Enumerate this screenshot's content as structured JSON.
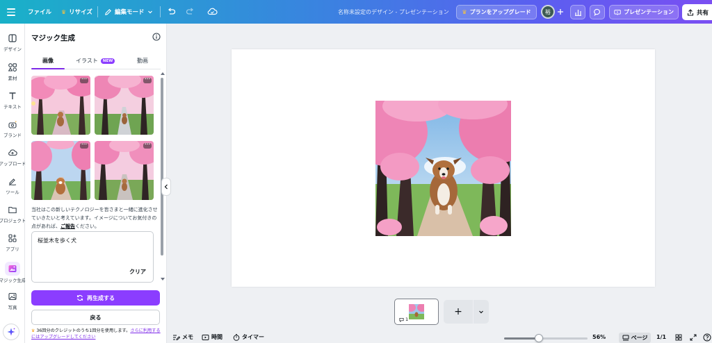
{
  "topbar": {
    "file_label": "ファイル",
    "resize_label": "リサイズ",
    "edit_mode_label": "編集モード",
    "doc_title": "名称未設定のデザイン - プレゼンテーション",
    "upgrade_label": "プランをアップグレード",
    "avatar_initial": "裕",
    "present_label": "プレゼンテーション",
    "share_label": "共有"
  },
  "rail": {
    "items": [
      {
        "label": "デザイン",
        "icon": "layout-icon"
      },
      {
        "label": "素材",
        "icon": "elements-icon"
      },
      {
        "label": "テキスト",
        "icon": "text-icon"
      },
      {
        "label": "ブランド",
        "icon": "brand-icon"
      },
      {
        "label": "アップロード",
        "icon": "upload-icon"
      },
      {
        "label": "ツール",
        "icon": "draw-icon"
      },
      {
        "label": "プロジェクト",
        "icon": "folder-icon"
      },
      {
        "label": "アプリ",
        "icon": "apps-icon"
      },
      {
        "label": "マジック生成",
        "icon": "magic-media-icon"
      },
      {
        "label": "写真",
        "icon": "photo-icon"
      }
    ]
  },
  "panel": {
    "title": "マジック生成",
    "tabs": [
      {
        "label": "画像"
      },
      {
        "label": "イラスト",
        "badge": "NEW"
      },
      {
        "label": "動画"
      }
    ],
    "more_glyph": "···",
    "disclaimer_text": "当社はこの新しいテクノロジーを皆さまと一緒に進化させていきたいと考えています。イメージについてお気付きの点があれば、",
    "disclaimer_link": "ご報告",
    "disclaimer_tail": "ください。",
    "prompt_value": "桜並木を歩く犬",
    "clear_label": "クリア",
    "regenerate_label": "再生成する",
    "back_label": "戻る",
    "credits_text": "36回分のクレジットのうち1回分を使用します。",
    "credits_link": "さらに利用するにはアップグレードしてください"
  },
  "pages": {
    "thumb_number": "1",
    "add_glyph": "+"
  },
  "bottombar": {
    "notes_label": "メモ",
    "duration_label": "時間",
    "timer_label": "タイマー",
    "zoom_label": "56%",
    "zoom_fraction": 0.42,
    "pages_label": "ページ",
    "page_count": "1/1"
  },
  "colors": {
    "accent": "#8b3dff",
    "topbar_gradient_start": "#19b1c8",
    "topbar_gradient_end": "#7a4ff2"
  }
}
